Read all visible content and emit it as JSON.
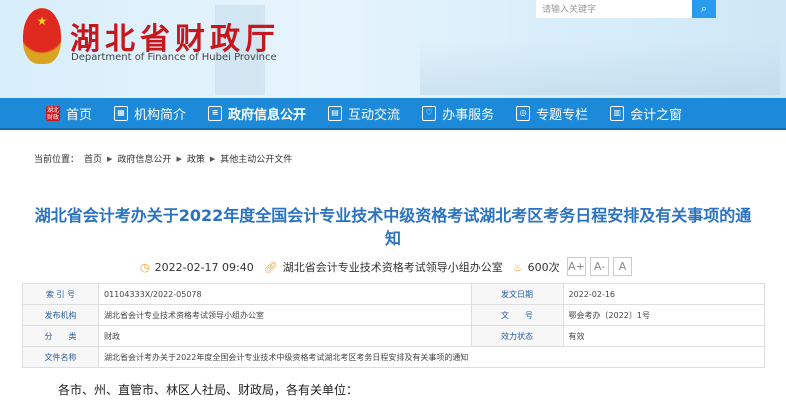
{
  "header": {
    "logo_cn": "湖北省财政厅",
    "logo_en": "Department of Finance of Hubei Province",
    "emblem_mark": "★",
    "search_placeholder": "请输入关键字",
    "search_icon": "search-icon"
  },
  "nav": [
    {
      "label": "首页",
      "icon": "湖北财政"
    },
    {
      "label": "机构简介",
      "icon": "▦"
    },
    {
      "label": "政府信息公开",
      "icon": "≡"
    },
    {
      "label": "互动交流",
      "icon": "▤"
    },
    {
      "label": "办事服务",
      "icon": "♡"
    },
    {
      "label": "专题专栏",
      "icon": "◎"
    },
    {
      "label": "会计之窗",
      "icon": "▥"
    }
  ],
  "breadcrumb": {
    "label": "当前位置：",
    "items": [
      "首页",
      "政府信息公开",
      "政策",
      "其他主动公开文件"
    ]
  },
  "article": {
    "title": "湖北省会计考办关于2022年度全国会计专业技术中级资格考试湖北考区考务日程安排及有关事项的通知",
    "date": "2022-02-17 09:40",
    "source": "湖北省会计专业技术资格考试领导小组办公室",
    "views": "600次",
    "font_buttons": [
      "A+",
      "A-",
      "A"
    ]
  },
  "info_table": {
    "index_label": "索 引 号",
    "index": "01104333X/2022-05078",
    "date_label": "发文日期",
    "date": "2022-02-16",
    "org_label": "发布机构",
    "org": "湖北省会计专业技术资格考试领导小组办公室",
    "docno_label": "文　　号",
    "docno": "鄂会考办〔2022〕1号",
    "cat_label": "分　　类",
    "cat": "财政",
    "status_label": "效力状态",
    "status": "有效",
    "name_label": "文件名称",
    "name": "湖北省会计考办关于2022年度全国会计专业技术中级资格考试湖北考区考务日程安排及有关事项的通知"
  },
  "body": {
    "salutation": "各市、州、直管市、林区人社局、财政局，各有关单位："
  },
  "colors": {
    "nav": "#1d8ad9",
    "title": "#2a72c2",
    "logo": "#c8161d"
  }
}
